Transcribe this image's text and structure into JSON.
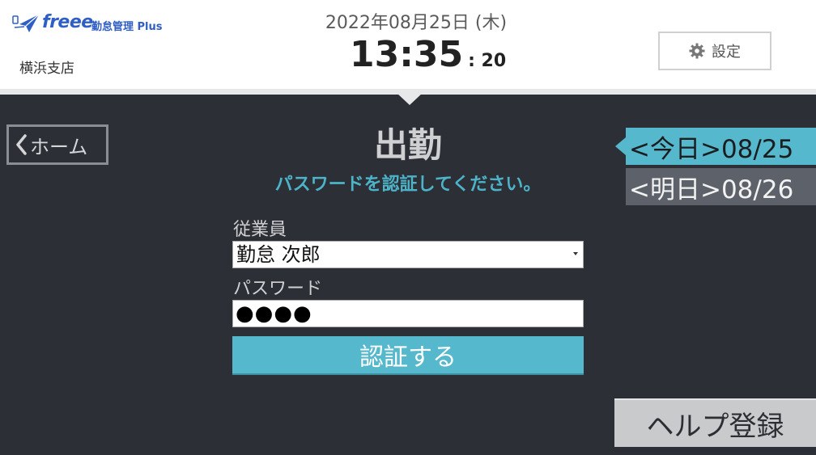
{
  "header": {
    "logo_text": "freee",
    "product_name": "勤怠管理 Plus",
    "branch": "横浜支店",
    "date": "2022年08月25日 (木)",
    "time_hm": "13:35",
    "time_sec": ": 20",
    "settings_label": "設定"
  },
  "nav": {
    "home_label": "ホーム"
  },
  "main": {
    "title": "出勤",
    "subtitle": "パスワードを認証してください。",
    "employee_label": "従業員",
    "employee_value": "勤怠 次郎",
    "password_label": "パスワード",
    "password_value": "●●●●",
    "submit_label": "認証する"
  },
  "day_selector": {
    "today": "<今日>08/25",
    "tomorrow": "<明日>08/26"
  },
  "footer": {
    "help_label": "ヘルプ登録"
  },
  "colors": {
    "accent": "#56b8cc",
    "background": "#2c2f36",
    "brand": "#2f5ec4"
  },
  "icons": {
    "logo": "paper-plane-icon",
    "settings": "gear-icon",
    "home": "chevron-left-icon"
  }
}
